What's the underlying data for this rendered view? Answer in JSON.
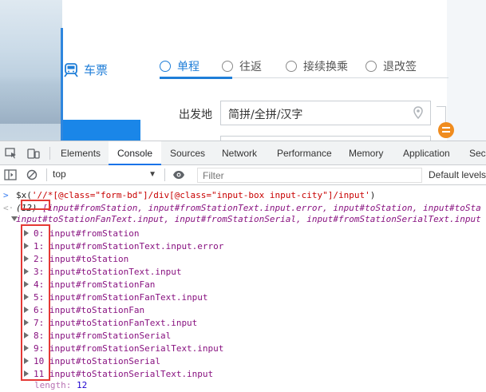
{
  "webpage": {
    "ticket_tab_label": "车票",
    "tabs": [
      {
        "label": "单程",
        "active": true
      },
      {
        "label": "往返",
        "active": false
      },
      {
        "label": "接续换乘",
        "active": false
      },
      {
        "label": "退改签",
        "active": false
      }
    ],
    "from_label": "出发地",
    "from_input_value": "简拼/全拼/汉字"
  },
  "devtools": {
    "tabs": [
      {
        "label": "Elements",
        "active": false
      },
      {
        "label": "Console",
        "active": true
      },
      {
        "label": "Sources",
        "active": false
      },
      {
        "label": "Network",
        "active": false
      },
      {
        "label": "Performance",
        "active": false
      },
      {
        "label": "Memory",
        "active": false
      },
      {
        "label": "Application",
        "active": false
      },
      {
        "label": "Secu",
        "active": false
      }
    ],
    "context": "top",
    "filter_placeholder": "Filter",
    "levels_label": "Default levels",
    "console": {
      "prompt": ">",
      "return_marker": "<·",
      "command_prefix": "$x(",
      "command_string": "'//*[@class=\"form-bd\"]/div[@class=\"input-box input-city\"]/input'",
      "command_suffix": ")",
      "summary_count": "(12)",
      "summary_line1": "[input#fromStation, input#fromStationText.input.error, input#toStation, input#toSta",
      "summary_line2": "input#toStationFanText.input, input#fromStationSerial, input#fromStationSerialText.input",
      "items": [
        {
          "index": "0:",
          "value": "input#fromStation"
        },
        {
          "index": "1:",
          "value": "input#fromStationText.input.error"
        },
        {
          "index": "2:",
          "value": "input#toStation"
        },
        {
          "index": "3:",
          "value": "input#toStationText.input"
        },
        {
          "index": "4:",
          "value": "input#fromStationFan"
        },
        {
          "index": "5:",
          "value": "input#fromStationFanText.input"
        },
        {
          "index": "6:",
          "value": "input#toStationFan"
        },
        {
          "index": "7:",
          "value": "input#toStationFanText.input"
        },
        {
          "index": "8:",
          "value": "input#fromStationSerial"
        },
        {
          "index": "9:",
          "value": "input#fromStationSerialText.input"
        },
        {
          "index": "10",
          "value": "input#toStationSerial"
        },
        {
          "index": "11",
          "value": "input#toStationSerialText.input"
        }
      ],
      "length_key": "length:",
      "length_value": "12"
    }
  },
  "colors": {
    "brand_blue": "#1f7ed8",
    "swap_orange": "#f08c1e",
    "highlight_red": "#e53935",
    "console_purple": "#881280"
  }
}
